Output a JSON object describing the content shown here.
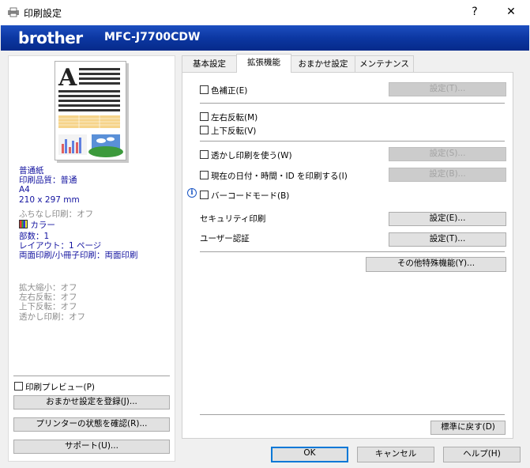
{
  "window": {
    "title": "印刷設定",
    "help_glyph": "?",
    "close_glyph": "✕"
  },
  "banner": {
    "brand": "brother",
    "model": "MFC-J7700CDW"
  },
  "summary": {
    "lines_blue_1": [
      "普通紙",
      "印刷品質：普通",
      "A4",
      "210 x 297 mm"
    ],
    "borderless": "ふちなし印刷：オフ",
    "color": "カラー",
    "lines_blue_2": [
      "部数：1",
      "レイアウト：1 ページ",
      "両面印刷/小冊子印刷：両面印刷"
    ],
    "lines_gray": [
      "拡大縮小：オフ",
      "左右反転：オフ",
      "上下反転：オフ",
      "透かし印刷：オフ"
    ]
  },
  "left_controls": {
    "print_preview": "印刷プレビュー(P)",
    "register_preset": "おまかせ設定を登録(J)...",
    "printer_status": "プリンターの状態を確認(R)...",
    "support": "サポート(U)..."
  },
  "tabs": [
    {
      "label": "基本設定",
      "active": false
    },
    {
      "label": "拡張機能",
      "active": true
    },
    {
      "label": "おまかせ設定",
      "active": false
    },
    {
      "label": "メンテナンス",
      "active": false
    }
  ],
  "advanced": {
    "color_correction": {
      "label": "色補正(E)",
      "button": "設定(T)...",
      "checked": false
    },
    "mirror": {
      "label": "左右反転(M)",
      "checked": false
    },
    "reverse": {
      "label": "上下反転(V)",
      "checked": false
    },
    "watermark": {
      "label": "透かし印刷を使う(W)",
      "button": "設定(S)...",
      "checked": false
    },
    "header_footer": {
      "label": "現在の日付・時間・ID を印刷する(I)",
      "button": "設定(B)...",
      "checked": false
    },
    "barcode": {
      "label": "バーコードモード(B)",
      "checked": false
    },
    "secure_print": {
      "label": "セキュリティ印刷",
      "button": "設定(E)..."
    },
    "user_auth": {
      "label": "ユーザー認証",
      "button": "設定(T)..."
    },
    "other_features": "その他特殊機能(Y)...",
    "default": "標準に戻す(D)"
  },
  "dialog_buttons": {
    "ok": "OK",
    "cancel": "キャンセル",
    "help": "ヘルプ(H)"
  },
  "colors": {
    "banner_blue": "#0c37a2",
    "summary_blue": "#1414a0",
    "focus_blue": "#0078d7"
  }
}
